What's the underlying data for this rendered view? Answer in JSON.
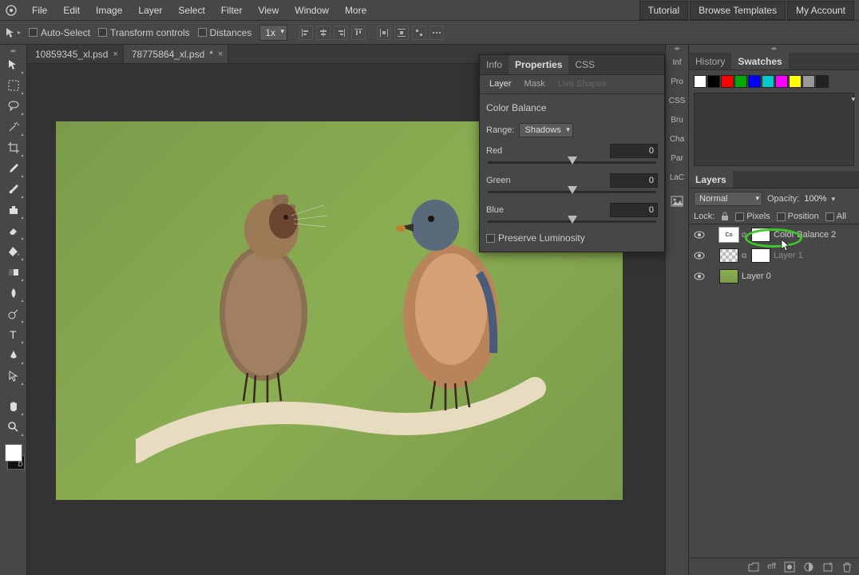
{
  "menu": {
    "items": [
      "File",
      "Edit",
      "Image",
      "Layer",
      "Select",
      "Filter",
      "View",
      "Window",
      "More"
    ],
    "right": [
      "Tutorial",
      "Browse Templates",
      "My Account"
    ]
  },
  "options_bar": {
    "auto_select": "Auto-Select",
    "transform_controls": "Transform controls",
    "distances": "Distances",
    "zoom": "1x"
  },
  "tabs": [
    {
      "name": "10859345_xl.psd",
      "dirty": false,
      "active": false
    },
    {
      "name": "78775864_xl.psd",
      "dirty": true,
      "active": true
    }
  ],
  "side_strip": {
    "items": [
      "Inf",
      "Pro",
      "CSS",
      "Bru",
      "Cha",
      "Par",
      "LaC"
    ]
  },
  "props_panel": {
    "tabs": [
      "Info",
      "Properties",
      "CSS"
    ],
    "active_tab": "Properties",
    "subtabs": [
      "Layer",
      "Mask",
      "Live Shapes"
    ],
    "active_subtab": "Layer",
    "title": "Color Balance",
    "range_label": "Range:",
    "range_value": "Shadows",
    "sliders": [
      {
        "label": "Red",
        "value": "0"
      },
      {
        "label": "Green",
        "value": "0"
      },
      {
        "label": "Blue",
        "value": "0"
      }
    ],
    "preserve_luminosity": "Preserve Luminosity"
  },
  "history_swatches": {
    "tabs": [
      "History",
      "Swatches"
    ],
    "active": "Swatches",
    "colors": [
      "#ffffff",
      "#000000",
      "#ff0000",
      "#00aa00",
      "#0000ff",
      "#00cccc",
      "#ff00ff",
      "#ffff00",
      "#999999",
      "#222222"
    ]
  },
  "layers_panel": {
    "title": "Layers",
    "blend_mode": "Normal",
    "opacity_label": "Opacity:",
    "opacity_value": "100%",
    "lock_label": "Lock:",
    "lock_pixels": "Pixels",
    "lock_position": "Position",
    "lock_all": "All",
    "layers": [
      {
        "name": "Color Balance 2",
        "type": "adj"
      },
      {
        "name": "Layer 1",
        "type": "layer",
        "clipped": true
      },
      {
        "name": "Layer 0",
        "type": "image"
      }
    ],
    "footer_eff": "eff"
  },
  "swatch_label": "D"
}
